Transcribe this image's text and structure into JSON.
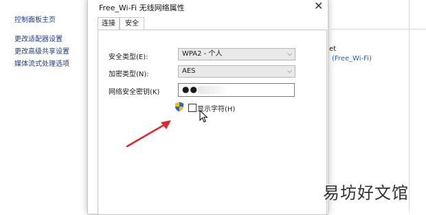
{
  "control_panel": {
    "links": [
      {
        "label": "控制面板主页"
      },
      {
        "label": "更改适配器设置"
      },
      {
        "label": "更改高级共享设置"
      },
      {
        "label": "媒体流式处理选项"
      }
    ],
    "right_fragment_1": "et",
    "right_fragment_2": "(Free_Wi-Fi)"
  },
  "dialog": {
    "title": "Free_Wi-Fi 无线网络属性",
    "close_glyph": "✕",
    "tabs": [
      {
        "label": "连接",
        "active": false
      },
      {
        "label": "安全",
        "active": true
      }
    ],
    "security_type": {
      "label": "安全类型(E):",
      "value": "WPA2 - 个人"
    },
    "encryption_type": {
      "label": "加密类型(N):",
      "value": "AES"
    },
    "network_key": {
      "label": "网络安全密钥(K)",
      "value": "●●●"
    },
    "show_characters": {
      "label": "显示字符(H)",
      "checked": false
    }
  },
  "annotation": {
    "arrow_color": "#e0262c"
  },
  "watermark": {
    "text": "易坊好文馆"
  }
}
